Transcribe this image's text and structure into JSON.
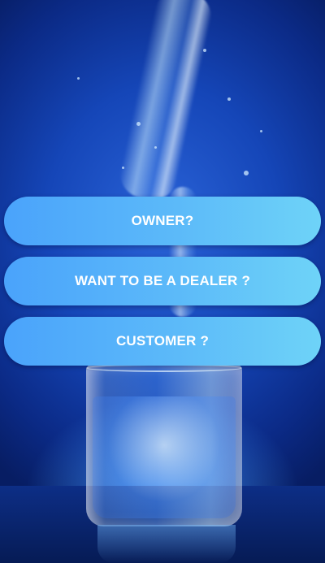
{
  "menu": {
    "buttons": [
      {
        "label": "OWNER?"
      },
      {
        "label": "WANT TO BE A DEALER ?"
      },
      {
        "label": "CUSTOMER ?"
      }
    ]
  },
  "background": {
    "image": "water-pouring-into-glass",
    "colors": {
      "deep": "#071d63",
      "mid": "#1546b8",
      "glow": "#46a0ff"
    }
  },
  "button_gradient": {
    "start": "#4aa3fb",
    "end": "#6ed3f8"
  }
}
